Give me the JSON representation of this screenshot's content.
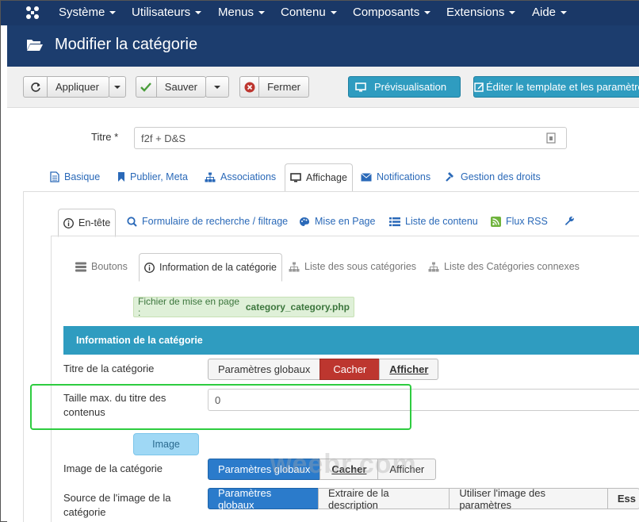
{
  "topnav": {
    "items": [
      "Système",
      "Utilisateurs",
      "Menus",
      "Contenu",
      "Composants",
      "Extensions",
      "Aide"
    ]
  },
  "header": {
    "title": "Modifier la catégorie"
  },
  "toolbar": {
    "apply": "Appliquer",
    "save": "Sauver",
    "close": "Fermer",
    "preview": "Prévisualisation",
    "edit_template": "Éditer le template et les paramètres"
  },
  "form": {
    "title_label": "Titre *",
    "title_value": "f2f + D&S"
  },
  "main_tabs": [
    "Basique",
    "Publier, Meta",
    "Associations",
    "Affichage",
    "Notifications",
    "Gestion des droits"
  ],
  "sub_tabs": [
    "En-tête",
    "Formulaire de recherche / filtrage",
    "Mise en Page",
    "Liste de contenu",
    "Flux RSS"
  ],
  "third_tabs": [
    "Boutons",
    "Information de la catégorie",
    "Liste des sous catégories",
    "Liste des Catégories connexes"
  ],
  "notice": {
    "prefix": "Fichier de mise en page :",
    "file": "category_category.php"
  },
  "section": {
    "title": "Information de la catégorie"
  },
  "fields": {
    "cat_title": {
      "label": "Titre de la catégorie",
      "options": [
        "Paramètres globaux",
        "Cacher",
        "Afficher"
      ]
    },
    "max_title": {
      "label": "Taille max. du titre des contenus",
      "value": "0"
    },
    "image_button": "Image",
    "cat_image": {
      "label": "Image de la catégorie",
      "options": [
        "Paramètres globaux",
        "Cacher",
        "Afficher"
      ]
    },
    "image_source": {
      "label": "Source de l'image de la catégorie",
      "options": [
        "Paramètres globaux",
        "Extraire de la description",
        "Utiliser l'image des paramètres",
        "Ess"
      ]
    }
  },
  "watermark": "weebr.com",
  "colors": {
    "nav": "#1a3867",
    "header": "#1c3d6e",
    "accent_blue": "#2f9cc0",
    "active_blue": "#2b7bcb",
    "active_red": "#bd362f",
    "highlight_green": "#2ecc40"
  }
}
